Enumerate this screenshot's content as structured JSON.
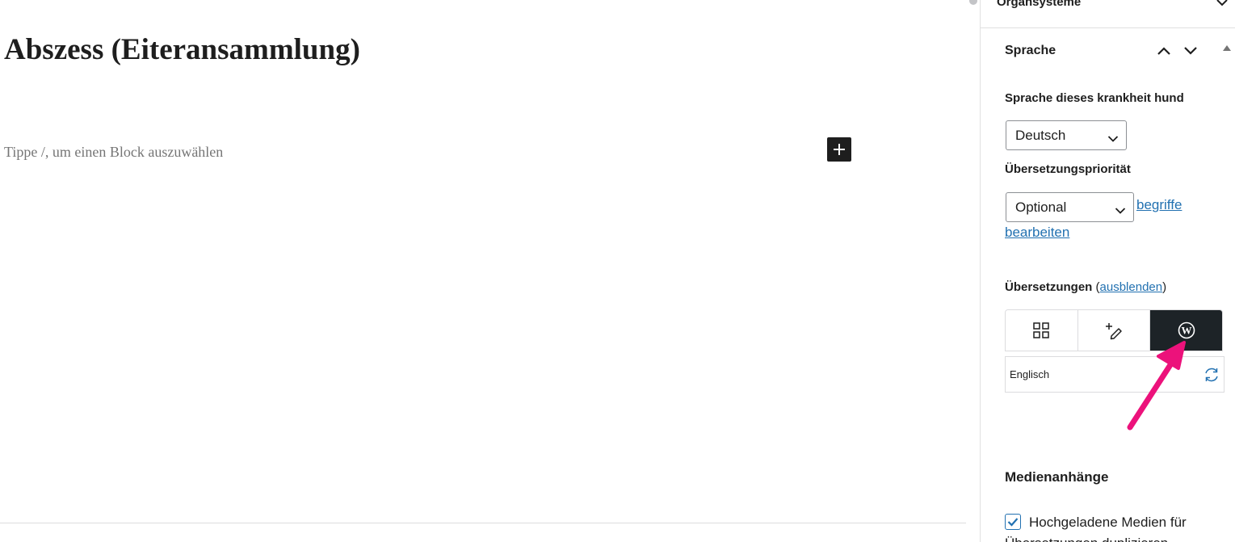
{
  "editor": {
    "post_title": "Abszess (Eiteransammlung)",
    "block_placeholder": "Tippe /, um einen Block auszuwählen",
    "add_block_label": "+"
  },
  "sidebar": {
    "organsysteme_panel": {
      "title": "Organsysteme"
    },
    "sprache_panel": {
      "title": "Sprache",
      "language_label": "Sprache dieses krankheit hund",
      "language_value": "Deutsch",
      "priority_label": "Übersetzungspriorität",
      "priority_value": "Optional",
      "edit_terms_link_line1": "begriffe",
      "edit_terms_link_line2": "bearbeiten",
      "translations_label": "Übersetzungen",
      "translations_paren_open": " (",
      "hide_link": "ausblenden",
      "translations_paren_close": ")",
      "tabs": [
        {
          "icon": "grid-icon",
          "active": false
        },
        {
          "icon": "add-edit-icon",
          "active": false
        },
        {
          "icon": "wordpress-icon",
          "active": true
        }
      ],
      "translation_languages": [
        {
          "name": "Englisch",
          "action_icon": "sync-icon"
        }
      ]
    },
    "media_panel": {
      "title": "Medienanhänge",
      "checkbox_checked": true,
      "checkbox_label_line1": "Hochgeladene Medien für",
      "checkbox_label_line2": "Übersetzungen duplizieren"
    }
  },
  "colors": {
    "active_tab": "#1d2327",
    "link": "#2271b1",
    "annotation_arrow": "#ec127b"
  }
}
